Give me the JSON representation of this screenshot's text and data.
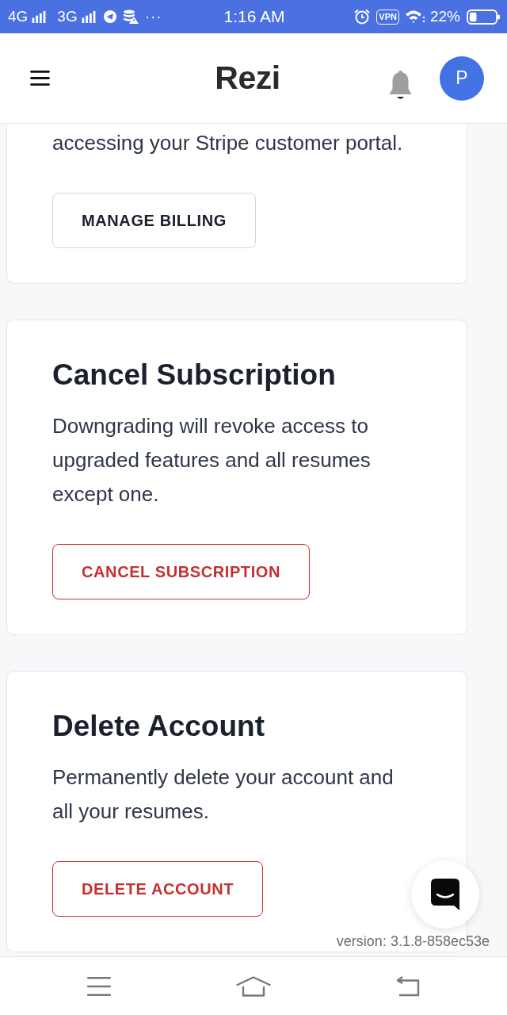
{
  "status_bar": {
    "network_1": "4G",
    "network_2": "3G",
    "more": "···",
    "time": "1:16 AM",
    "vpn": "VPN",
    "battery": "22%"
  },
  "header": {
    "logo": "Rezi",
    "avatar_initial": "P"
  },
  "cards": [
    {
      "text": "accessing your Stripe customer portal.",
      "button": {
        "label": "MANAGE BILLING",
        "kind": "neutral"
      }
    },
    {
      "title": "Cancel Subscription",
      "text": "Downgrading will revoke access to upgraded features and all resumes except one.",
      "button": {
        "label": "CANCEL SUBSCRIPTION",
        "kind": "danger"
      }
    },
    {
      "title": "Delete Account",
      "text": "Permanently delete your account and all your resumes.",
      "button": {
        "label": "DELETE ACCOUNT",
        "kind": "danger"
      }
    }
  ],
  "version": "version: 3.1.8-858ec53e"
}
